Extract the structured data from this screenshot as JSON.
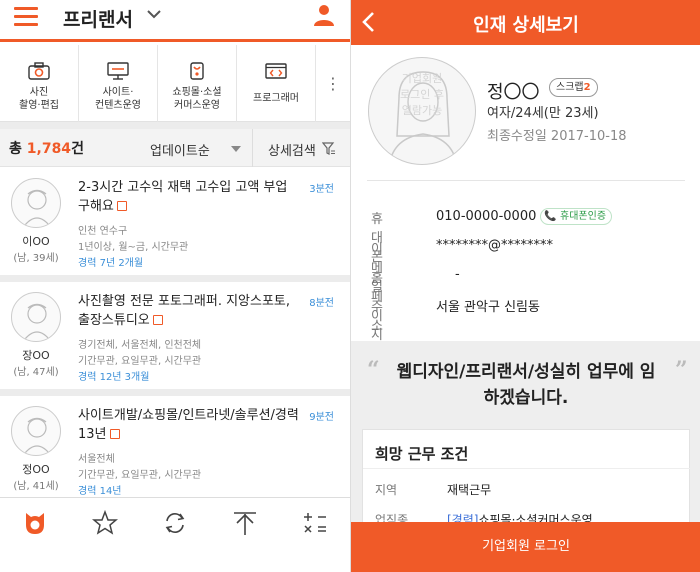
{
  "left": {
    "header": {
      "title": "프리랜서"
    },
    "categories": [
      {
        "label": "사진\n촬영·편집",
        "icon": "camera-icon"
      },
      {
        "label": "사이트·\n컨텐츠운영",
        "icon": "monitor-icon"
      },
      {
        "label": "쇼핑몰·소셜\n커머스운영",
        "icon": "bag-icon"
      },
      {
        "label": "프로그래머",
        "icon": "code-icon"
      }
    ],
    "filter": {
      "total_prefix": "총",
      "total_count": "1,784",
      "total_suffix": "건",
      "sort": "업데이트순",
      "detail": "상세검색"
    },
    "items": [
      {
        "title": "2-3시간 고수익 재택 고수입 고액 부업 구해요",
        "time": "3분전",
        "name": "이OO",
        "info": "(남, 39세)",
        "line1": "인천 연수구",
        "line2": "1년이상, 월~금, 시간무관",
        "career": "경력 7년 2개월"
      },
      {
        "title": "사진촬영 전문 포토그래퍼. 지앙스포토,출장스튜디오",
        "time": "8분전",
        "name": "장OO",
        "info": "(남, 47세)",
        "line1": "경기전체, 서울전체, 인천전체",
        "line2": "기간무관, 요일무관, 시간무관",
        "career": "경력 12년 3개월"
      },
      {
        "title": "사이트개발/쇼핑몰/인트라넷/솔루션/경력13년",
        "time": "9분전",
        "name": "정OO",
        "info": "(남, 41세)",
        "line1": "서울전체",
        "line2": "기간무관, 요일무관, 시간무관",
        "career": "경력 14년"
      }
    ],
    "bottom_nav": [
      "home-icon",
      "star-icon",
      "refresh-icon",
      "top-icon",
      "calculator-icon"
    ]
  },
  "right": {
    "header": {
      "title": "인재 상세보기"
    },
    "profile": {
      "watermark": "기업회원\n로그인 후\n열람가능",
      "name": "정〇〇",
      "scrap_label": "스크랩",
      "scrap_count": "2",
      "gender_age": "여자/24세(만 23세)",
      "modified": "최종수정일 2017-10-18"
    },
    "contact": [
      {
        "key": "휴대폰",
        "value": "010-0000-0000",
        "badge": "휴대폰인증"
      },
      {
        "key": "이메일",
        "value": "********@********"
      },
      {
        "key": "홈페이지",
        "value": "-"
      },
      {
        "key": "주소",
        "value": "서울 관악구 신림동"
      }
    ],
    "quote": "웹디자인/프리랜서/성실히 업무에 임하겠습니다.",
    "card": {
      "title": "희망 근무 조건",
      "rows": [
        {
          "key": "지역",
          "value": "재택근무"
        },
        {
          "key": "업직종",
          "value_highlight": "[경력]",
          "value": "쇼핑몰·소셜커머스운영,"
        }
      ]
    },
    "login_button": "기업회원 로그인",
    "accent": "#f05a28"
  }
}
